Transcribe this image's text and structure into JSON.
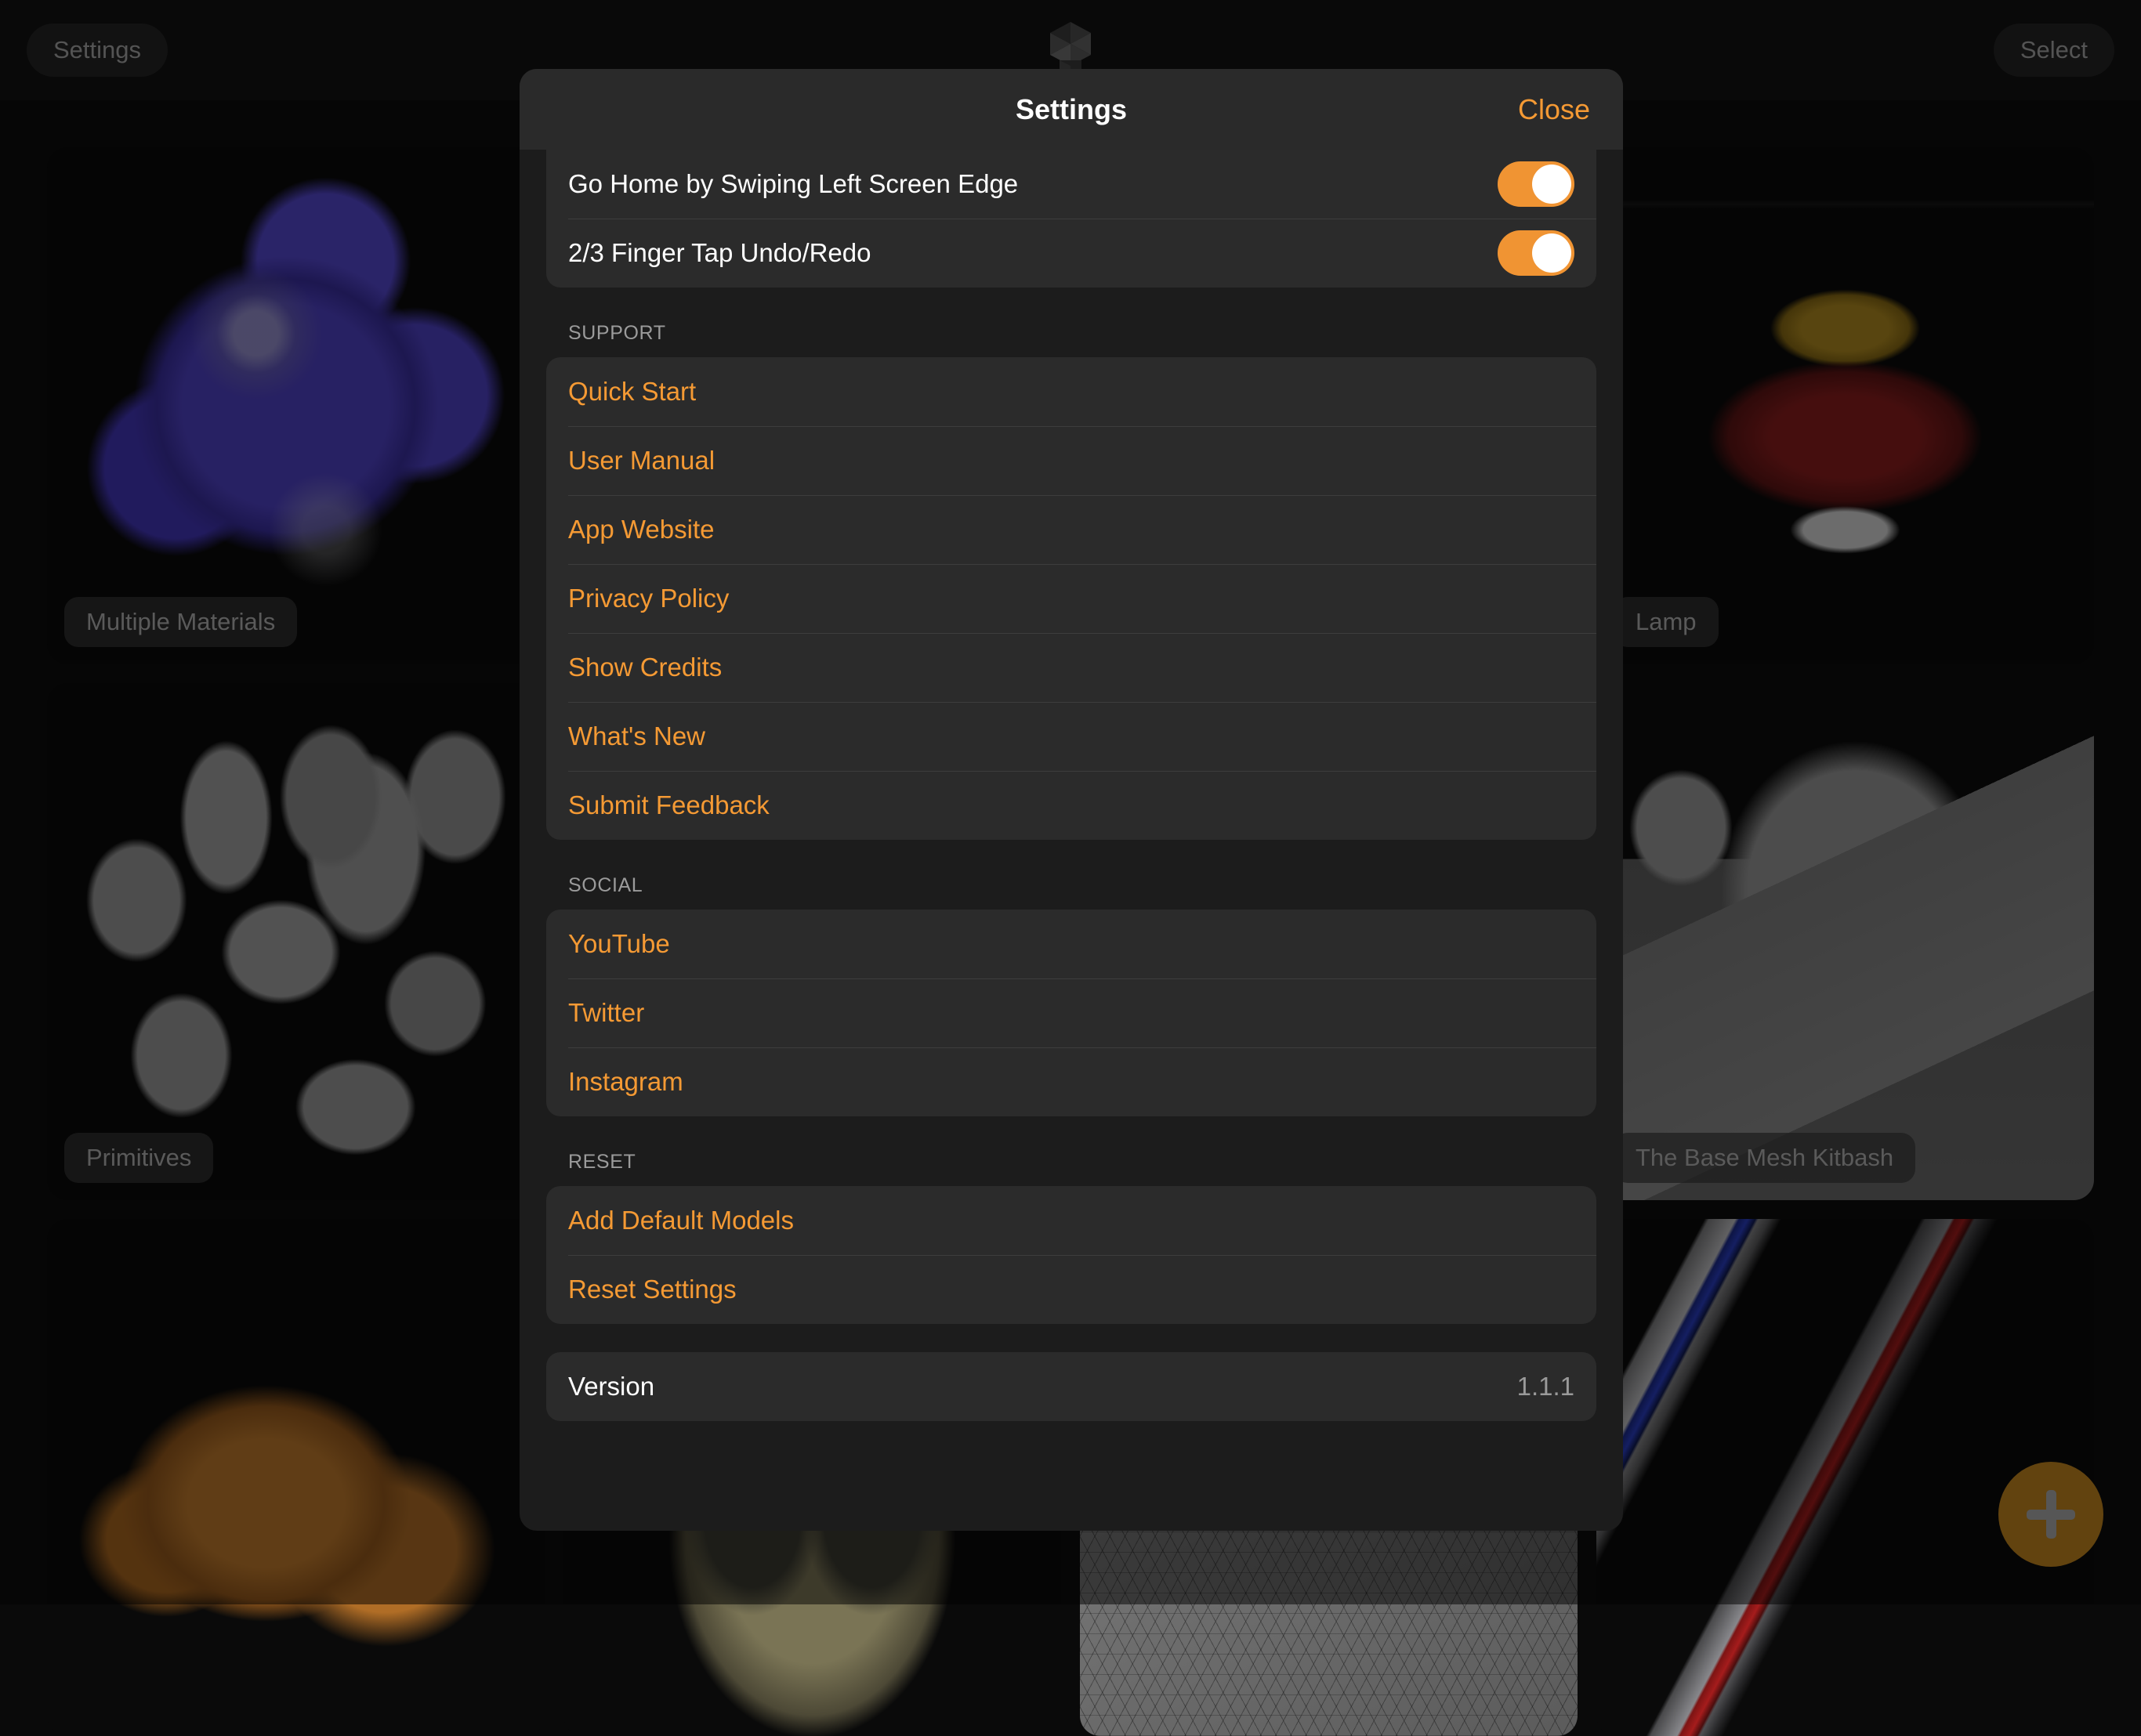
{
  "topbar": {
    "settings_label": "Settings",
    "select_label": "Select",
    "logo_name": "app-logo"
  },
  "gallery": {
    "tiles": [
      {
        "label": "Multiple Materials",
        "art": "art-mm"
      },
      {
        "label": "",
        "art": ""
      },
      {
        "label": "",
        "art": ""
      },
      {
        "label": "Lamp",
        "art": "art-lamp"
      },
      {
        "label": "Primitives",
        "art": "art-prim"
      },
      {
        "label": "",
        "art": ""
      },
      {
        "label": "",
        "art": ""
      },
      {
        "label": "The Base Mesh Kitbash",
        "art": "art-kit"
      },
      {
        "label": "",
        "art": "art-blob"
      },
      {
        "label": "",
        "art": "art-mask"
      },
      {
        "label": "",
        "art": "art-terrain"
      },
      {
        "label": "",
        "art": "art-ring"
      }
    ],
    "add_button_label": "+"
  },
  "modal": {
    "title": "Settings",
    "close_label": "Close",
    "toggles": [
      {
        "label": "Go Home by Swiping Left Screen Edge",
        "on": true
      },
      {
        "label": "2/3 Finger Tap Undo/Redo",
        "on": true
      }
    ],
    "sections": [
      {
        "title": "SUPPORT",
        "items": [
          "Quick Start",
          "User Manual",
          "App Website",
          "Privacy Policy",
          "Show Credits",
          "What's New",
          "Submit Feedback"
        ]
      },
      {
        "title": "SOCIAL",
        "items": [
          "YouTube",
          "Twitter",
          "Instagram"
        ]
      },
      {
        "title": "RESET",
        "items": [
          "Add Default Models",
          "Reset Settings"
        ]
      }
    ],
    "version": {
      "label": "Version",
      "value": "1.1.1"
    }
  },
  "colors": {
    "accent": "#f59a34",
    "toggle_on": "#f09433",
    "modal_bg": "#1c1c1c",
    "row_bg": "#2b2b2b",
    "header_bg": "#2a2a2a"
  }
}
